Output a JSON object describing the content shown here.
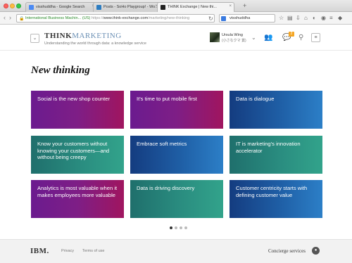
{
  "browser": {
    "tabs": [
      {
        "label": "visshuddha - Google Search",
        "active": false
      },
      {
        "label": "Posts - SoHo Playgroup! - Wo...",
        "active": false
      },
      {
        "label": "THINK Exchange | New thi...",
        "active": true
      }
    ],
    "url_ev_label": "International Business Machin... (US)",
    "url_prefix": "https://",
    "url_host": "www.think-exchange.com",
    "url_path": "/marketing/new-thinking",
    "search_value": "visshuddha"
  },
  "header": {
    "brand_think": "THINK",
    "brand_marketing": "MARKETING",
    "tagline": "Understanding the world through data: a knowledge service",
    "user_name": "Ursula Wing",
    "user_sub": "(小さなクマ 賞)",
    "notification_count": "2"
  },
  "page": {
    "title": "New thinking"
  },
  "cards": [
    {
      "title": "Social is the new shop counter",
      "color": "#7e1e86"
    },
    {
      "title": "It's time to put mobile first",
      "color": "#7e1e86"
    },
    {
      "title": "Data is dialogue",
      "color": "#1f5fa6"
    },
    {
      "title": "Know your customers without knowing your customers—and without being creepy",
      "color": "#2a8d80"
    },
    {
      "title": "Embrace soft metrics",
      "color": "#1f5fa6"
    },
    {
      "title": "IT is marketing's innovation accelerator",
      "color": "#2a8d80"
    },
    {
      "title": "Analytics is most valuable when it makes employees more valuable",
      "color": "#7e1e86"
    },
    {
      "title": "Data is driving discovery",
      "color": "#2a8d80"
    },
    {
      "title": "Customer centricity starts with defining customer value",
      "color": "#1f5fa6"
    }
  ],
  "pagination": {
    "pages": 4,
    "current": 1
  },
  "footer": {
    "logo": "IBM.",
    "privacy": "Privacy",
    "terms": "Terms of use",
    "concierge": "Concierge services"
  },
  "icons": {
    "people": "people-icon",
    "chat": "chat-icon",
    "search": "search-icon",
    "menu": "hamburger-icon",
    "concierge": "person-icon"
  }
}
